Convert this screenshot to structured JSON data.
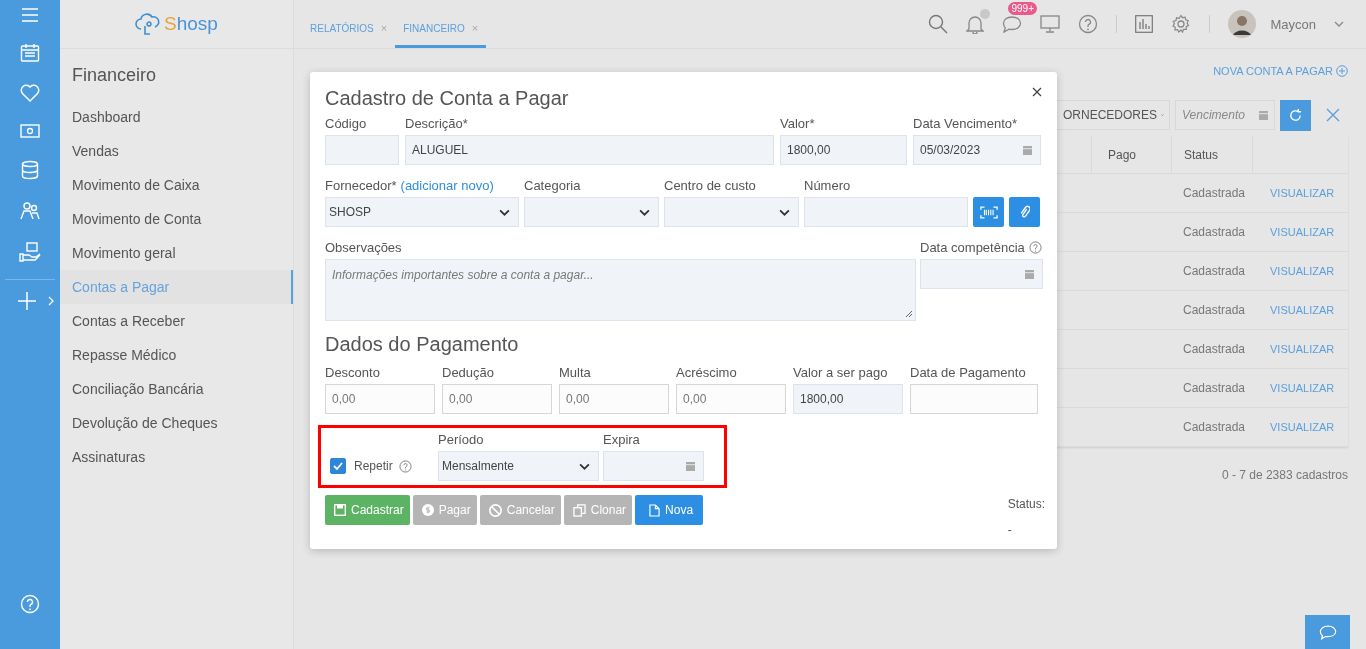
{
  "logo": {
    "text": "Shosp"
  },
  "tabs": [
    {
      "label": "RELATÓRIOS",
      "selected": false,
      "close": "×"
    },
    {
      "label": "FINANCEIRO",
      "selected": true,
      "close": "×"
    }
  ],
  "top_bar": {
    "badge": "999+",
    "user": "Maycon"
  },
  "side_menu": {
    "title": "Financeiro",
    "items": [
      {
        "label": "Dashboard",
        "selected": false
      },
      {
        "label": "Vendas",
        "selected": false
      },
      {
        "label": "Movimento de Caixa",
        "selected": false
      },
      {
        "label": "Movimento de Conta",
        "selected": false
      },
      {
        "label": "Movimento geral",
        "selected": false
      },
      {
        "label": "Contas a Pagar",
        "selected": true
      },
      {
        "label": "Contas a Receber",
        "selected": false
      },
      {
        "label": "Repasse Médico",
        "selected": false
      },
      {
        "label": "Conciliação Bancária",
        "selected": false
      },
      {
        "label": "Devolução de Cheques",
        "selected": false
      },
      {
        "label": "Assinaturas",
        "selected": false
      }
    ]
  },
  "page": {
    "new_link": "NOVA CONTA A PAGAR",
    "filter": {
      "supplier": "ORNECEDORES",
      "date_placeholder": "Vencimento"
    },
    "table": {
      "columns": [
        "Pago",
        "Status"
      ],
      "rows": [
        {
          "status": "Cadastrada",
          "action": "VISUALIZAR"
        },
        {
          "status": "Cadastrada",
          "action": "VISUALIZAR"
        },
        {
          "status": "Cadastrada",
          "action": "VISUALIZAR"
        },
        {
          "status": "Cadastrada",
          "action": "VISUALIZAR"
        },
        {
          "status": "Cadastrada",
          "action": "VISUALIZAR"
        },
        {
          "status": "Cadastrada",
          "action": "VISUALIZAR"
        },
        {
          "status": "Cadastrada",
          "action": "VISUALIZAR"
        }
      ]
    },
    "pagination": "0 - 7 de 2383 cadastros"
  },
  "modal": {
    "title": "Cadastro de Conta a Pagar",
    "row1": [
      {
        "label": "Código",
        "kind": "text"
      },
      {
        "label": "Descrição*",
        "kind": "text",
        "value": "ALUGUEL"
      },
      {
        "label": "Valor*",
        "kind": "text",
        "value": "1800,00"
      },
      {
        "label": "Data Vencimento*",
        "kind": "date",
        "value": "05/03/2023"
      }
    ],
    "supplier": {
      "label": "Fornecedor*",
      "link": "(adicionar novo)",
      "value": "SHOSP"
    },
    "category": {
      "label": "Categoria"
    },
    "cost_center": {
      "label": "Centro de custo"
    },
    "number": {
      "label": "Número"
    },
    "notes": {
      "label": "Observações",
      "placeholder": "Informações importantes sobre a conta a pagar..."
    },
    "competence": {
      "label": "Data competência"
    },
    "payment_title": "Dados do Pagamento",
    "payment": [
      {
        "label": "Desconto",
        "value": "0,00",
        "disabled": true
      },
      {
        "label": "Dedução",
        "value": "0,00",
        "disabled": true
      },
      {
        "label": "Multa",
        "value": "0,00",
        "disabled": true
      },
      {
        "label": "Acréscimo",
        "value": "0,00",
        "disabled": true
      },
      {
        "label": "Valor a ser pago",
        "value": "1800,00",
        "disabled": false
      },
      {
        "label": "Data de Pagamento",
        "disabled": true
      }
    ],
    "repeat": {
      "label": "Repetir",
      "checked": true,
      "highlighted": true,
      "period_label": "Período",
      "period": "Mensalmente",
      "expires_label": "Expira"
    },
    "buttons": [
      {
        "label": "Cadastrar",
        "kind": "save",
        "disabled": false
      },
      {
        "label": "Pagar",
        "kind": "pay",
        "disabled": true
      },
      {
        "label": "Cancelar",
        "kind": "cancel",
        "disabled": true
      },
      {
        "label": "Clonar",
        "kind": "clone",
        "disabled": true
      },
      {
        "label": "Nova",
        "kind": "new",
        "disabled": false
      }
    ],
    "status": {
      "label": "Status:",
      "value": "-"
    }
  }
}
